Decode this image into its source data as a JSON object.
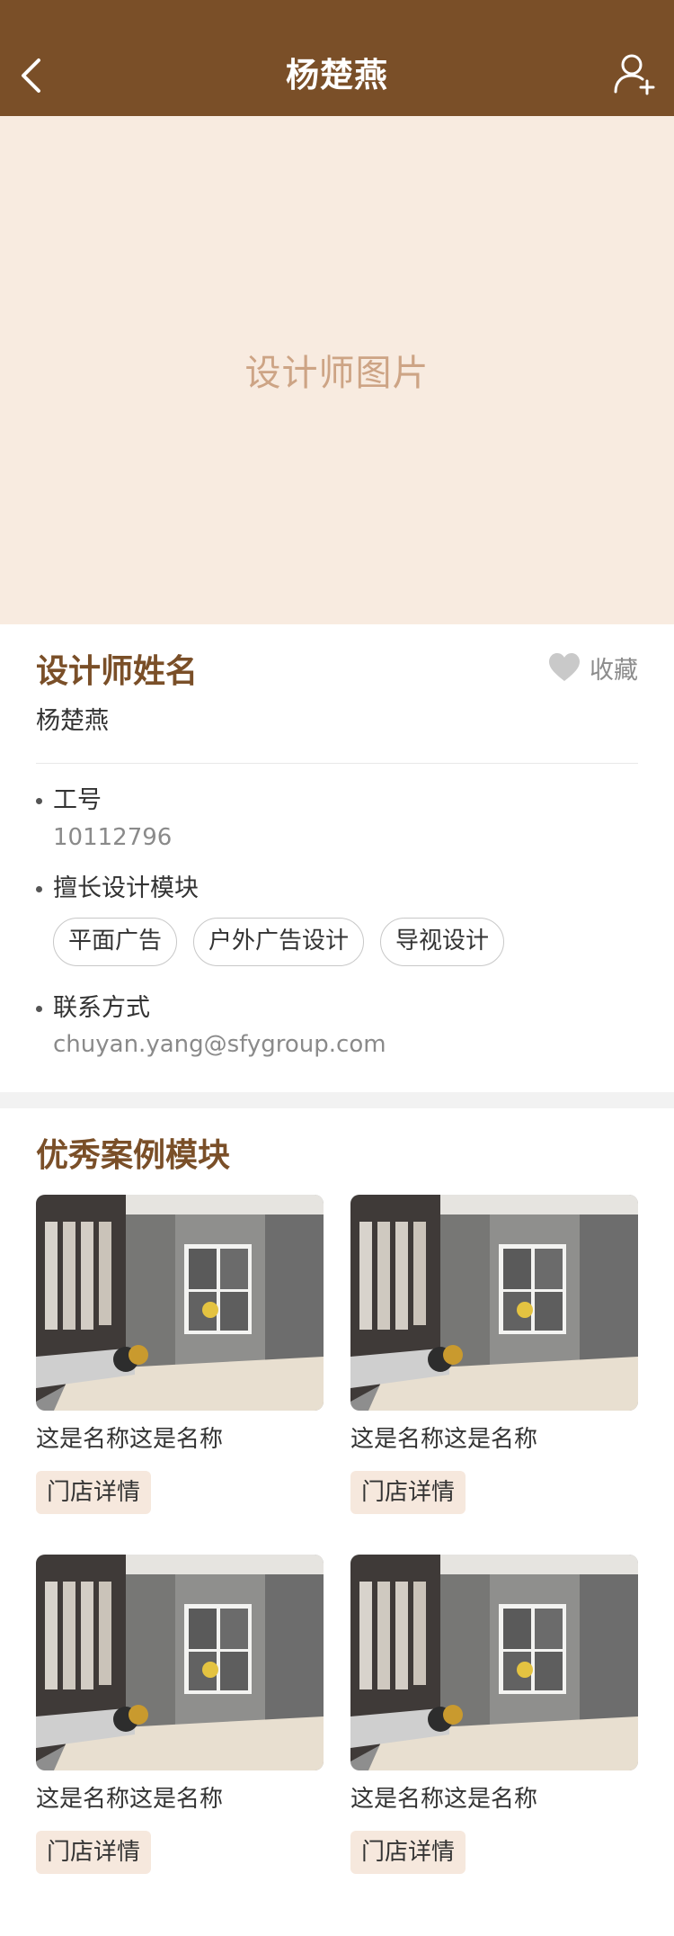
{
  "header": {
    "title": "杨楚燕",
    "back_icon": "chevron-left-icon",
    "action_icon": "add-user-icon",
    "bg_color": "#7a4f28"
  },
  "hero": {
    "placeholder": "设计师图片",
    "bg_color": "#f8ebe0"
  },
  "designer": {
    "section_title": "设计师姓名",
    "name": "杨楚燕",
    "favorite_label": "收藏",
    "favorite_icon": "heart-icon",
    "id_label": "工号",
    "id_value": "10112796",
    "skills_label": "擅长设计模块",
    "skills": [
      "平面广告",
      "户外广告设计",
      "导视设计"
    ],
    "contact_label": "联系方式",
    "contact_value": "chuyan.yang@sfygroup.com"
  },
  "cases": {
    "section_title": "优秀案例模块",
    "items": [
      {
        "name": "这是名称这是名称",
        "button": "门店详情"
      },
      {
        "name": "这是名称这是名称",
        "button": "门店详情"
      },
      {
        "name": "这是名称这是名称",
        "button": "门店详情"
      },
      {
        "name": "这是名称这是名称",
        "button": "门店详情"
      }
    ]
  },
  "colors": {
    "accent": "#7a4f28",
    "button_bg": "#f6e8dd"
  }
}
